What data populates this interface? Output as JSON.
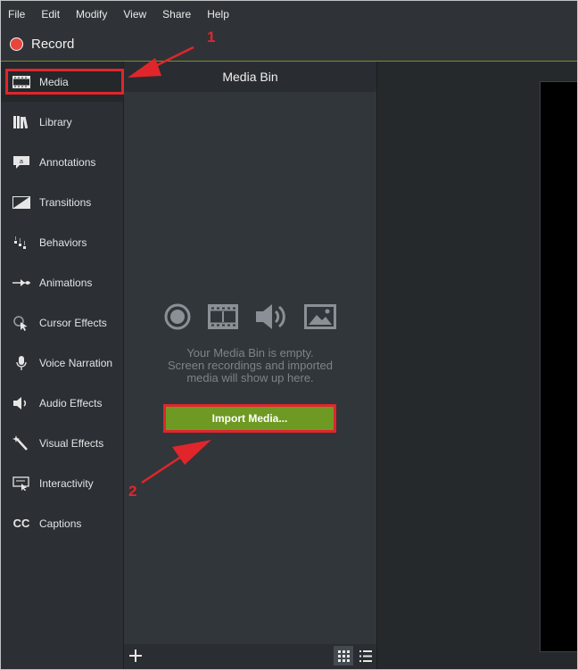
{
  "menu": [
    "File",
    "Edit",
    "Modify",
    "View",
    "Share",
    "Help"
  ],
  "record_label": "Record",
  "sidebar": {
    "items": [
      {
        "label": "Media",
        "icon": "film-icon"
      },
      {
        "label": "Library",
        "icon": "library-icon"
      },
      {
        "label": "Annotations",
        "icon": "annotation-icon"
      },
      {
        "label": "Transitions",
        "icon": "transition-icon"
      },
      {
        "label": "Behaviors",
        "icon": "behaviors-icon"
      },
      {
        "label": "Animations",
        "icon": "animation-icon"
      },
      {
        "label": "Cursor Effects",
        "icon": "cursor-icon"
      },
      {
        "label": "Voice Narration",
        "icon": "microphone-icon"
      },
      {
        "label": "Audio Effects",
        "icon": "speaker-icon"
      },
      {
        "label": "Visual Effects",
        "icon": "magic-wand-icon"
      },
      {
        "label": "Interactivity",
        "icon": "interactivity-icon"
      },
      {
        "label": "Captions",
        "icon": "cc-icon",
        "glyph": "CC"
      }
    ]
  },
  "media_bin": {
    "title": "Media Bin",
    "empty_line1": "Your Media Bin is empty.",
    "empty_line2": "Screen recordings and imported",
    "empty_line3": "media will show up here.",
    "import_label": "Import Media..."
  },
  "annotations": {
    "step1": "1",
    "step2": "2"
  },
  "colors": {
    "accent_green": "#6e9a23",
    "highlight_red": "#e0262b",
    "record_red": "#e8453c"
  }
}
